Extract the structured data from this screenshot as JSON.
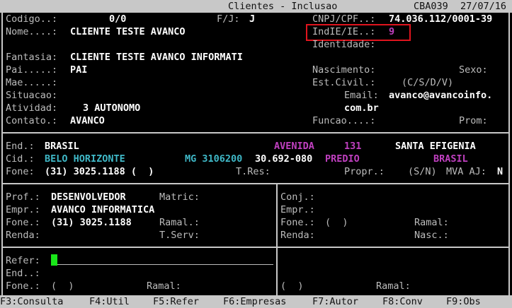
{
  "title": {
    "window": "Clientes - Inclusao",
    "program": "CBA039",
    "date": "27/07/16"
  },
  "header": {
    "codigo_label": "Codigo..:",
    "codigo_value": "0/0",
    "fj_label": "F/J:",
    "fj_value": "J",
    "cnpj_label": "CNPJ/CPF..:",
    "cnpj_value": "74.036.112/0001-39",
    "nome_label": "Nome....:",
    "nome_value": "CLIENTE TESTE AVANCO",
    "indie_label": "IndIE/IE..:",
    "indie_value": "9",
    "identidade_label": "Identidade:",
    "fantasia_label": "Fantasia:",
    "fantasia_value": "CLIENTE TESTE AVANCO INFORMATI",
    "pai_label": "Pai.....:",
    "pai_value": "PAI",
    "nascimento_label": "Nascimento:",
    "sexo_label": "Sexo:",
    "mae_label": "Mae.....:",
    "estcivil_label": "Est.Civil.:",
    "estcivil_options": "(C/S/D/V)",
    "situacao_label": "Situacao:",
    "email_label": "Email:",
    "email_value_1": "avanco@avancoinfo.",
    "email_value_2": "com.br",
    "atividade_label": "Atividad:",
    "atividade_value": "3 AUTONOMO",
    "contato_label": "Contato.:",
    "contato_value": "AVANCO",
    "funcao_label": "Funcao....:",
    "prom_label": "Prom:"
  },
  "address": {
    "end_label": "End.:",
    "end_value": "BRASIL",
    "logradouro_tipo": "AVENIDA",
    "numero": "131",
    "bairro": "SANTA EFIGENIA",
    "cid_label": "Cid.:",
    "cidade": "BELO HORIZONTE",
    "uf_ibge": "MG 3106200",
    "cep": "30.692-080",
    "complemento": "PREDIO",
    "pais": "BRASIL",
    "fone_label": "Fone:",
    "fone_value": "(31) 3025.1188 (  )",
    "tres_label": "T.Res:",
    "propr_label": "Propr.:",
    "propr_options": "(S/N)",
    "mva_label": "MVA AJ:",
    "mva_value": "N"
  },
  "work": {
    "prof_label": "Prof.:",
    "prof_value": "DESENVOLVEDOR",
    "matric_label": "Matric:",
    "empr_label": "Empr.:",
    "empr_value": "AVANCO INFORMATICA",
    "fone_label": "Fone.:",
    "fone_value": "(31) 3025.1188",
    "ramal_label": "Ramal.:",
    "renda_label": "Renda:",
    "tserv_label": "T.Serv:",
    "conj_label": "Conj.:",
    "empr2_label": "Empr.:",
    "fone2_label": "Fone.:",
    "fone2_value": "(  )",
    "ramal2_label": "Ramal:",
    "renda2_label": "Renda:",
    "nasc_label": "Nasc.:"
  },
  "refer": {
    "refer_label": "Refer:",
    "end_label": "End..:",
    "fone_label": "Fone.:",
    "fone_value": "(  )",
    "ramal_label": "Ramal:",
    "fone2_value": "(  )",
    "ramal2_label": "Ramal:"
  },
  "fkeys": [
    "F3:Consulta",
    "F4:Util",
    "F5:Refer",
    "F6:Empresas",
    "F7:Autor",
    "F8:Conv",
    "F9:Obs"
  ],
  "colors": {
    "highlight_box": "#e0141e",
    "cursor": "#19e619",
    "magenta": "#c040c0",
    "cyan": "#3fb8c7"
  }
}
